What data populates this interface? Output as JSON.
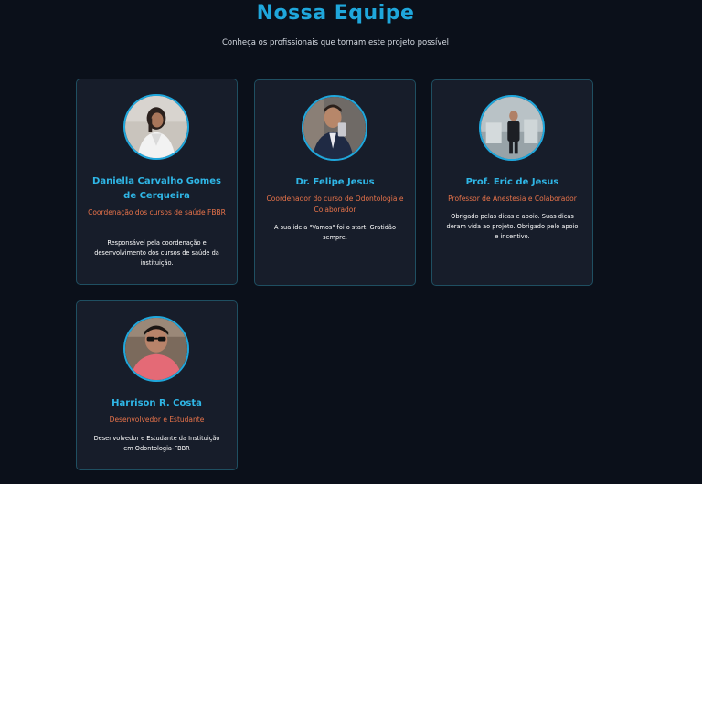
{
  "header": {
    "title": "Nossa Equipe",
    "subtitle": "Conheça os profissionais que tornam este projeto possível"
  },
  "colors": {
    "background": "#0b101a",
    "card": "#171d2a",
    "accent": "#1fa7dc",
    "role": "#e8734a"
  },
  "team": [
    {
      "name": "Daniella Carvalho Gomes de Cerqueira",
      "role": "Coordenação dos cursos de saúde FBBR",
      "description": "Responsável pela coordenação e desenvolvimento dos cursos de saúde da instituição.",
      "photo": "woman-white-coat-photo"
    },
    {
      "name": "Dr. Felipe Jesus",
      "role": "Coordenador do curso de Odontologia e Colaborador",
      "description": "A sua ideia \"Vamos\" foi o start. Gratidão sempre.",
      "photo": "man-suit-selfie-photo"
    },
    {
      "name": "Prof. Eric de Jesus",
      "role": "Professor de Anestesia e Colaborador",
      "description": "Obrigado pelas dicas e apoio. Suas dicas deram vida ao projeto. Obrigado pelo apoio e incentivo.",
      "photo": "man-clinic-mirror-photo"
    },
    {
      "name": "Harrison R. Costa",
      "role": "Desenvolvedor e Estudante",
      "description": "Desenvolvedor e Estudante da Instituição em Odontologia-FBBR",
      "photo": "man-sunglasses-photo"
    }
  ]
}
